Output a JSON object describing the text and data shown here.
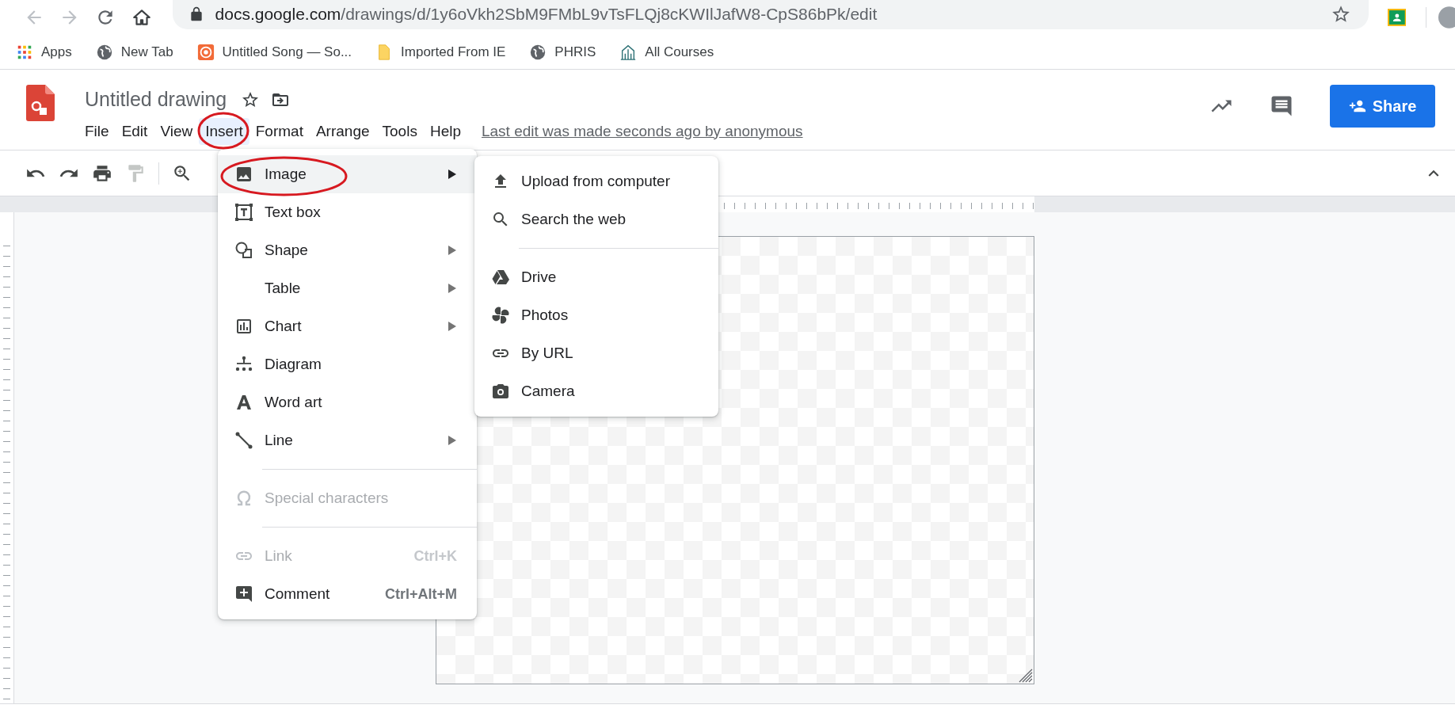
{
  "browser": {
    "back": {
      "disabled": true
    },
    "forward": {
      "disabled": true
    },
    "url_host": "docs.google.com",
    "url_path": "/drawings/d/1y6oVkh2SbM9FMbL9vTsFLQj8cKWIlJafW8-CpS86bPk/edit"
  },
  "bookmarks": [
    {
      "label": "Apps"
    },
    {
      "label": "New Tab"
    },
    {
      "label": "Untitled Song — So..."
    },
    {
      "label": "Imported From IE"
    },
    {
      "label": "PHRIS"
    },
    {
      "label": "All Courses"
    }
  ],
  "document": {
    "title": "Untitled drawing",
    "last_edit": "Last edit was made seconds ago by anonymous"
  },
  "menubar": [
    {
      "label": "File",
      "selected": false,
      "circled": false
    },
    {
      "label": "Edit",
      "selected": false,
      "circled": false
    },
    {
      "label": "View",
      "selected": false,
      "circled": false
    },
    {
      "label": "Insert",
      "selected": true,
      "circled": true
    },
    {
      "label": "Format",
      "selected": false,
      "circled": false
    },
    {
      "label": "Arrange",
      "selected": false,
      "circled": false
    },
    {
      "label": "Tools",
      "selected": false,
      "circled": false
    },
    {
      "label": "Help",
      "selected": false,
      "circled": false
    }
  ],
  "share_button": {
    "label": "Share"
  },
  "toolbar": {
    "paint_format": {
      "disabled": true
    }
  },
  "insert_menu": {
    "items": [
      {
        "kind": "item",
        "label": "Image",
        "selected": true,
        "circled": true,
        "submenu": true,
        "disabled": false
      },
      {
        "kind": "item",
        "label": "Text box",
        "selected": false,
        "circled": false,
        "submenu": false,
        "disabled": false
      },
      {
        "kind": "item",
        "label": "Shape",
        "selected": false,
        "circled": false,
        "submenu": true,
        "disabled": false
      },
      {
        "kind": "item",
        "label": "Table",
        "selected": false,
        "circled": false,
        "submenu": true,
        "disabled": false
      },
      {
        "kind": "item",
        "label": "Chart",
        "selected": false,
        "circled": false,
        "submenu": true,
        "disabled": false
      },
      {
        "kind": "item",
        "label": "Diagram",
        "selected": false,
        "circled": false,
        "submenu": false,
        "disabled": false
      },
      {
        "kind": "item",
        "label": "Word art",
        "selected": false,
        "circled": false,
        "submenu": false,
        "disabled": false
      },
      {
        "kind": "item",
        "label": "Line",
        "selected": false,
        "circled": false,
        "submenu": true,
        "disabled": false
      },
      {
        "kind": "separator"
      },
      {
        "kind": "item",
        "label": "Special characters",
        "selected": false,
        "circled": false,
        "submenu": false,
        "disabled": true
      },
      {
        "kind": "separator"
      },
      {
        "kind": "item",
        "label": "Link",
        "shortcut": "Ctrl+K",
        "selected": false,
        "circled": false,
        "submenu": false,
        "disabled": true
      },
      {
        "kind": "item",
        "label": "Comment",
        "shortcut": "Ctrl+Alt+M",
        "selected": false,
        "circled": false,
        "submenu": false,
        "disabled": false
      }
    ]
  },
  "image_submenu": {
    "items": [
      {
        "kind": "item",
        "label": "Upload from computer"
      },
      {
        "kind": "item",
        "label": "Search the web"
      },
      {
        "kind": "separator"
      },
      {
        "kind": "item",
        "label": "Drive"
      },
      {
        "kind": "item",
        "label": "Photos"
      },
      {
        "kind": "item",
        "label": "By URL"
      },
      {
        "kind": "item",
        "label": "Camera"
      }
    ]
  }
}
